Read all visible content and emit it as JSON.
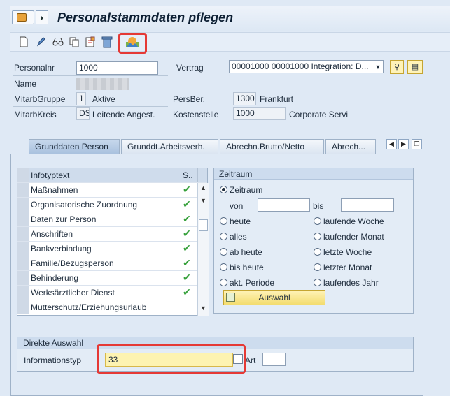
{
  "window": {
    "title": "Personalstammdaten pflegen"
  },
  "icons": {
    "app_menu": "app-menu-icon",
    "toolbar": [
      "new-document-icon",
      "edit-pencil-icon",
      "glasses-display-icon",
      "copy-icon",
      "change-history-icon",
      "delete-trash-icon",
      "overview-landscape-icon"
    ]
  },
  "header": {
    "personalnr_label": "Personalnr",
    "personalnr_value": "1000",
    "vertrag_label": "Vertrag",
    "vertrag_value": "00001000 00001000 Integration: D...",
    "name_label": "Name",
    "mitarbgruppe_label": "MitarbGruppe",
    "mitarbgruppe_code": "1",
    "mitarbgruppe_text": "Aktive",
    "persber_label": "PersBer.",
    "persber_code": "1300",
    "persber_text": "Frankfurt",
    "mitarbkreis_label": "MitarbKreis",
    "mitarbkreis_code": "DS",
    "mitarbkreis_text": "Leitende Angest.",
    "kostenstelle_label": "Kostenstelle",
    "kostenstelle_code": "1000",
    "kostenstelle_text": "Corporate Servi"
  },
  "tabs": [
    {
      "label": "Grunddaten Person",
      "active": true
    },
    {
      "label": "Grunddt.Arbeitsverh.",
      "active": false
    },
    {
      "label": "Abrechn.Brutto/Netto",
      "active": false
    },
    {
      "label": "Abrech...",
      "active": false
    }
  ],
  "infotable": {
    "col_text": "Infotyptext",
    "col_status": "S..",
    "rows": [
      {
        "text": "Maßnahmen",
        "status": "✔"
      },
      {
        "text": "Organisatorische Zuordnung",
        "status": "✔"
      },
      {
        "text": "Daten zur Person",
        "status": "✔"
      },
      {
        "text": "Anschriften",
        "status": "✔"
      },
      {
        "text": "Bankverbindung",
        "status": "✔"
      },
      {
        "text": "Familie/Bezugsperson",
        "status": "✔"
      },
      {
        "text": "Behinderung",
        "status": "✔"
      },
      {
        "text": "Werksärztlicher Dienst",
        "status": "✔"
      },
      {
        "text": "Mutterschutz/Erziehungsurlaub",
        "status": ""
      }
    ]
  },
  "zeitraum": {
    "title": "Zeitraum",
    "option_zeitraum": "Zeitraum",
    "von_label": "von",
    "bis_label": "bis",
    "von_value": "",
    "bis_value": "",
    "options_left": [
      "heute",
      "alles",
      "ab heute",
      "bis heute",
      "akt. Periode"
    ],
    "options_right": [
      "laufende Woche",
      "laufender Monat",
      "letzte Woche",
      "letzter Monat",
      "laufendes Jahr"
    ],
    "auswahl_label": "Auswahl"
  },
  "direkt": {
    "title": "Direkte Auswahl",
    "infotyp_label": "Informationstyp",
    "infotyp_value": "33",
    "art_label": "Art",
    "art_value": ""
  },
  "colors": {
    "highlight": "#e53935",
    "accent_yellow": "#f3dc6f",
    "check_green": "#35a03a"
  }
}
